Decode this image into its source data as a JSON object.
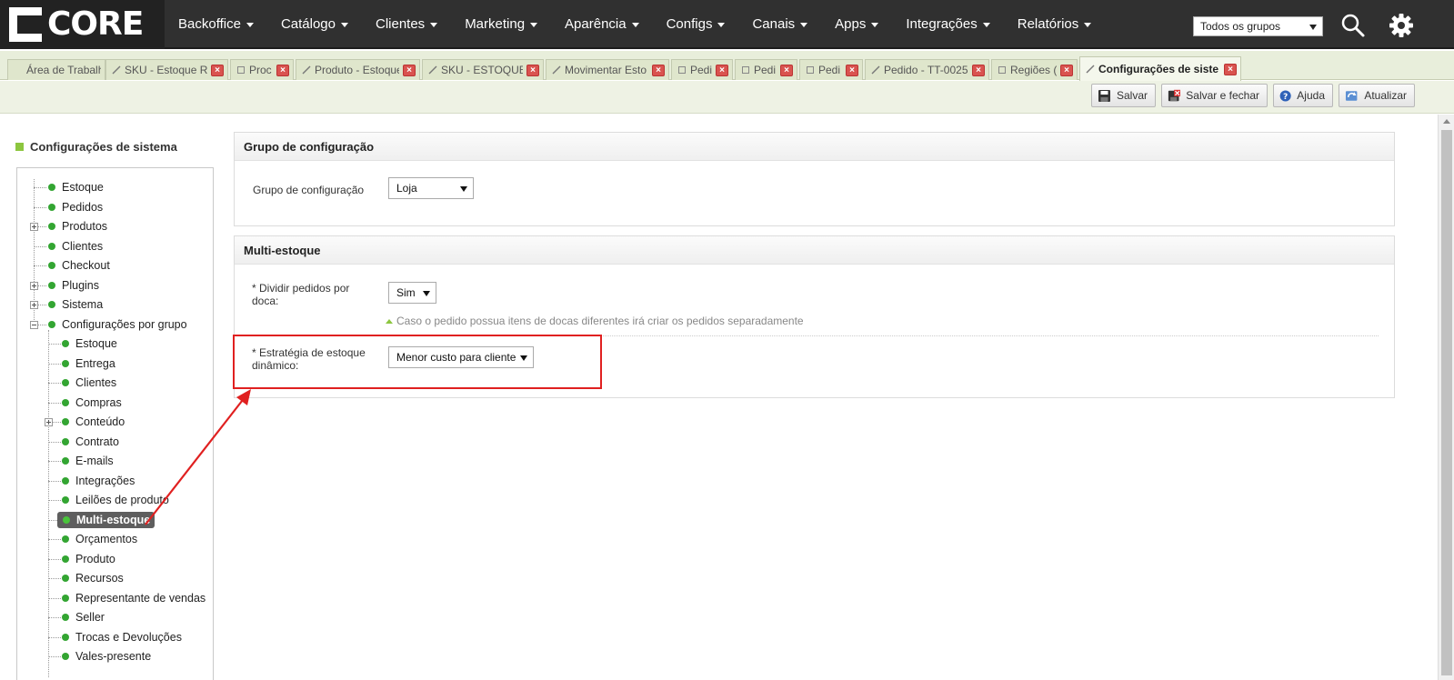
{
  "logo": {
    "text": "CORE"
  },
  "nav": {
    "menu": [
      {
        "label": "Backoffice"
      },
      {
        "label": "Catálogo"
      },
      {
        "label": "Clientes"
      },
      {
        "label": "Marketing"
      },
      {
        "label": "Aparência"
      },
      {
        "label": "Configs"
      },
      {
        "label": "Canais"
      },
      {
        "label": "Apps"
      },
      {
        "label": "Integrações"
      },
      {
        "label": "Relatórios"
      }
    ],
    "group_select": "Todos os grupos",
    "icons": [
      "search-icon",
      "gear-icon"
    ]
  },
  "tabs": [
    {
      "label": "Área de Trabalho",
      "icon": "none"
    },
    {
      "label": "SKU - Estoque R",
      "icon": "pencil-icon"
    },
    {
      "label": "Proc",
      "icon": "document-icon"
    },
    {
      "label": "Produto - Estoque",
      "icon": "pencil-icon"
    },
    {
      "label": "SKU - ESTOQUE",
      "icon": "pencil-icon"
    },
    {
      "label": "Movimentar Esto",
      "icon": "pencil-icon"
    },
    {
      "label": "Pedi",
      "icon": "document-icon"
    },
    {
      "label": "Pedi",
      "icon": "document-icon"
    },
    {
      "label": "Pedi",
      "icon": "document-icon"
    },
    {
      "label": "Pedido - TT-0025",
      "icon": "pencil-icon"
    },
    {
      "label": "Regiões (",
      "icon": "document-icon"
    },
    {
      "label": "Configurações de siste",
      "icon": "pencil-icon",
      "active": true
    }
  ],
  "tab_close_glyph": "×",
  "toolbar": {
    "save": "Salvar",
    "save_close": "Salvar e fechar",
    "help": "Ajuda",
    "refresh": "Atualizar"
  },
  "sidebar": {
    "title": "Configurações de sistema",
    "items": [
      {
        "label": "Estoque",
        "level": 0
      },
      {
        "label": "Pedidos",
        "level": 0
      },
      {
        "label": "Produtos",
        "level": 0,
        "expandable": "plus"
      },
      {
        "label": "Clientes",
        "level": 0
      },
      {
        "label": "Checkout",
        "level": 0
      },
      {
        "label": "Plugins",
        "level": 0,
        "expandable": "plus"
      },
      {
        "label": "Sistema",
        "level": 0,
        "expandable": "plus"
      },
      {
        "label": "Configurações por grupo",
        "level": 0,
        "expandable": "minus"
      },
      {
        "label": "Estoque",
        "level": 1
      },
      {
        "label": "Entrega",
        "level": 1
      },
      {
        "label": "Clientes",
        "level": 1
      },
      {
        "label": "Compras",
        "level": 1
      },
      {
        "label": "Conteúdo",
        "level": 1,
        "expandable": "plus"
      },
      {
        "label": "Contrato",
        "level": 1
      },
      {
        "label": "E-mails",
        "level": 1
      },
      {
        "label": "Integrações",
        "level": 1
      },
      {
        "label": "Leilões de produto",
        "level": 1
      },
      {
        "label": "Multi-estoque",
        "level": 1,
        "selected": true
      },
      {
        "label": "Orçamentos",
        "level": 1
      },
      {
        "label": "Produto",
        "level": 1
      },
      {
        "label": "Recursos",
        "level": 1
      },
      {
        "label": "Representante de vendas",
        "level": 1
      },
      {
        "label": "Seller",
        "level": 1
      },
      {
        "label": "Trocas e Devoluções",
        "level": 1
      },
      {
        "label": "Vales-presente",
        "level": 1
      }
    ]
  },
  "main": {
    "config_group": {
      "header": "Grupo de configuração",
      "label": "Grupo de configuração",
      "value": "Loja"
    },
    "multi_stock": {
      "header": "Multi-estoque",
      "split_label_1": "* Dividir pedidos por",
      "split_label_2": "doca:",
      "split_value": "Sim",
      "split_hint": "Caso o pedido possua itens de docas diferentes irá criar os pedidos separadamente",
      "strategy_label_1": "* Estratégia de estoque",
      "strategy_label_2": "dinâmico:",
      "strategy_value": "Menor custo para cliente"
    }
  },
  "colors": {
    "navbar": "#303030",
    "accent_green": "#8cc63f",
    "tree_dot": "#33a532",
    "annotation_red": "#e02020",
    "close_red": "#d9534f"
  }
}
